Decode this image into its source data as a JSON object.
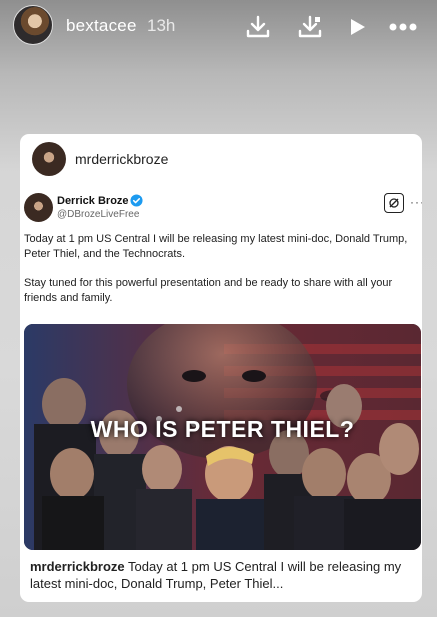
{
  "story": {
    "username": "bextacee",
    "time": "13h"
  },
  "icons": {
    "download": "download-icon",
    "save": "save-icon",
    "play": "play-icon",
    "more": "more-icon"
  },
  "card": {
    "account": "mrderrickbroze",
    "tweet": {
      "name": "Derrick Broze",
      "handle": "@DBrozeLiveFree",
      "paragraph1": "Today at 1 pm US Central I will be releasing my latest mini-doc, Donald Trump, Peter Thiel, and the Technocrats.",
      "paragraph2": "Stay tuned for this powerful presentation and be ready to share with all your friends and family."
    },
    "media_title": "WHO IS PETER THIEL?",
    "caption_user": "mrderrickbroze",
    "caption_text": "Today at 1 pm US Central I will be releasing my latest mini-doc, Donald Trump, Peter Thiel..."
  }
}
